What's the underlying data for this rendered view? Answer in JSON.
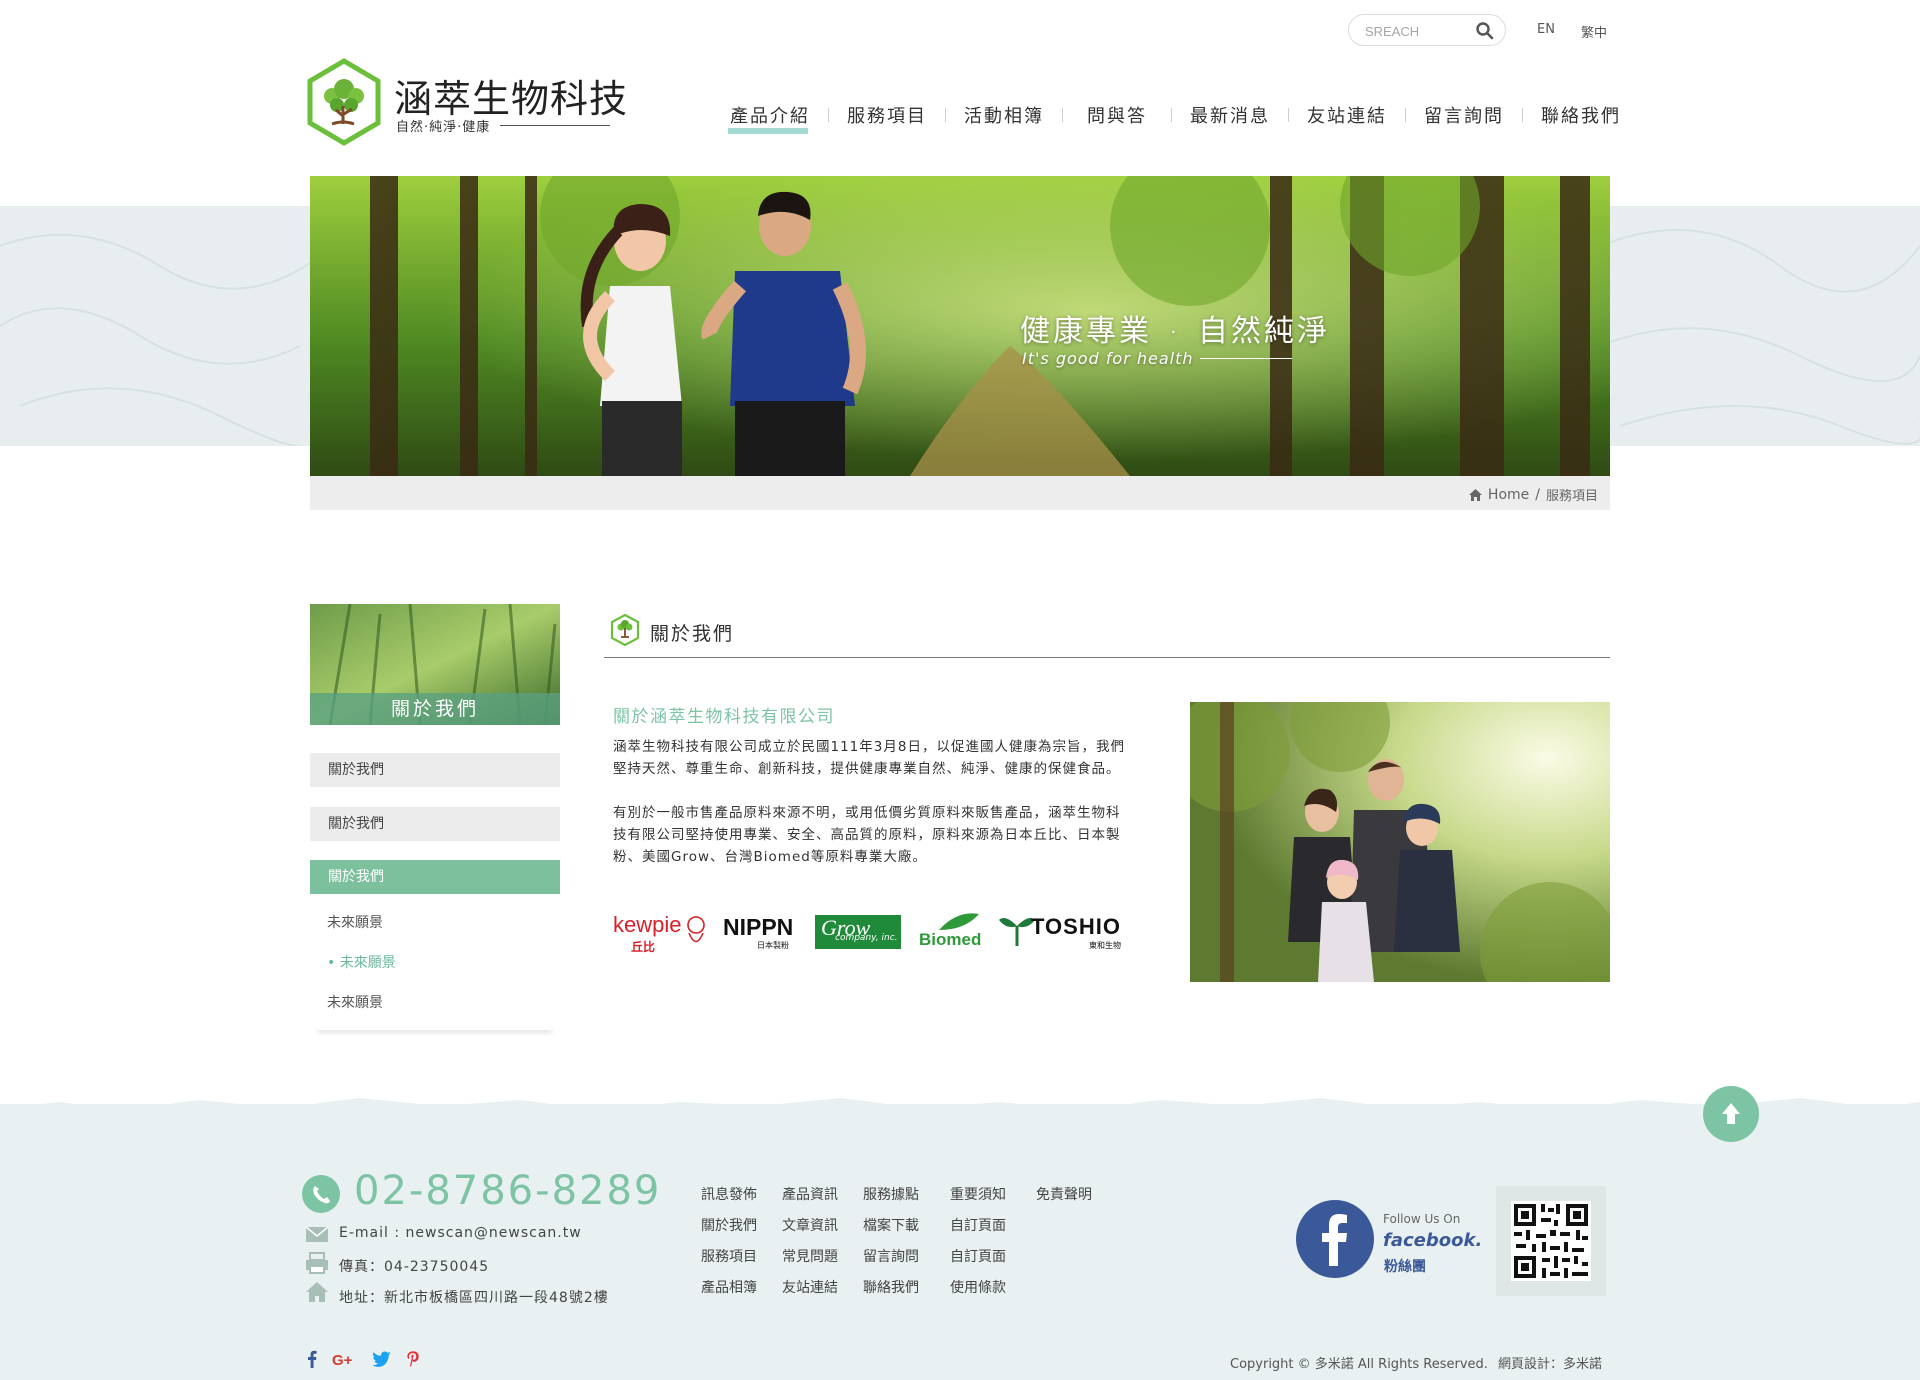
{
  "header": {
    "search_placeholder": "SREACH",
    "lang_en": "EN",
    "lang_zh": "繁中",
    "logo_title": "涵萃生物科技",
    "logo_subtitle": "自然·純淨·健康"
  },
  "nav": [
    {
      "label": "產品介紹",
      "active": true
    },
    {
      "label": "服務項目"
    },
    {
      "label": "活動相簿"
    },
    {
      "label": "問與答"
    },
    {
      "label": "最新消息"
    },
    {
      "label": "友站連結"
    },
    {
      "label": "留言詢問"
    },
    {
      "label": "聯絡我們"
    }
  ],
  "banner": {
    "slogan_a": "健康專業",
    "slogan_dot": "·",
    "slogan_b": "自然純淨",
    "slogan_en": "It's good for health"
  },
  "breadcrumb": {
    "home": "Home",
    "sep": "/",
    "current": "服務項目"
  },
  "sidebar": {
    "header": "關於我們",
    "items": [
      {
        "label": "關於我們"
      },
      {
        "label": "關於我們"
      },
      {
        "label": "關於我們",
        "active": true
      }
    ],
    "subitems": [
      {
        "label": "未來願景"
      },
      {
        "label": "• 未來願景",
        "active": true
      },
      {
        "label": "未來願景"
      }
    ]
  },
  "content": {
    "title": "關於我們",
    "subtitle": "關於涵萃生物科技有限公司",
    "para1_line1": "涵萃生物科技有限公司成立於民國111年3月8日，以促進國人健康為宗旨，我們",
    "para1_line2": "堅持天然、尊重生命、創新科技，提供健康專業自然、純淨、健康的保健食品。",
    "para2_line1": "有別於一般市售產品原料來源不明，或用低價劣質原料來販售產品，涵萃生物科",
    "para2_line2": "技有限公司堅持使用專業、安全、高品質的原料，原料來源為日本丘比、日本製",
    "para2_line3": "粉、美國Grow、台灣Biomed等原料專業大廠。",
    "brands": {
      "kewpie": "kewpie",
      "kewpie_zh": "丘比",
      "nippn": "NIPPN",
      "nippn_zh": "日本製粉",
      "grow": "Grow",
      "grow_sub": "company, inc.",
      "biomed": "Biomed",
      "toshio": "TOSHIO",
      "toshio_zh": "東和生物"
    }
  },
  "footer": {
    "phone": "02-8786-8289",
    "email": "E-mail : newscan@newscan.tw",
    "fax": "傳真：04-23750045",
    "address": "地址：新北市板橋區四川路一段48號2樓",
    "links": [
      "訊息發佈",
      "產品資訊",
      "服務據點",
      "重要須知",
      "免責聲明",
      "關於我們",
      "文章資訊",
      "檔案下載",
      "自訂頁面",
      "",
      "服務項目",
      "常見問題",
      "留言詢問",
      "自訂頁面",
      "",
      "產品相簿",
      "友站連結",
      "聯絡我們",
      "使用條款",
      ""
    ],
    "fb_follow": "Follow Us On",
    "fb_word": "facebook.",
    "fb_fans": "粉絲團",
    "copyright": "Copyright © 多米諾 All Rights Reserved.",
    "design": "網頁設計：多米諾"
  },
  "colors": {
    "accent": "#7cc4a4",
    "footer_bg": "#e8f0f1",
    "facebook": "#3b5998"
  }
}
